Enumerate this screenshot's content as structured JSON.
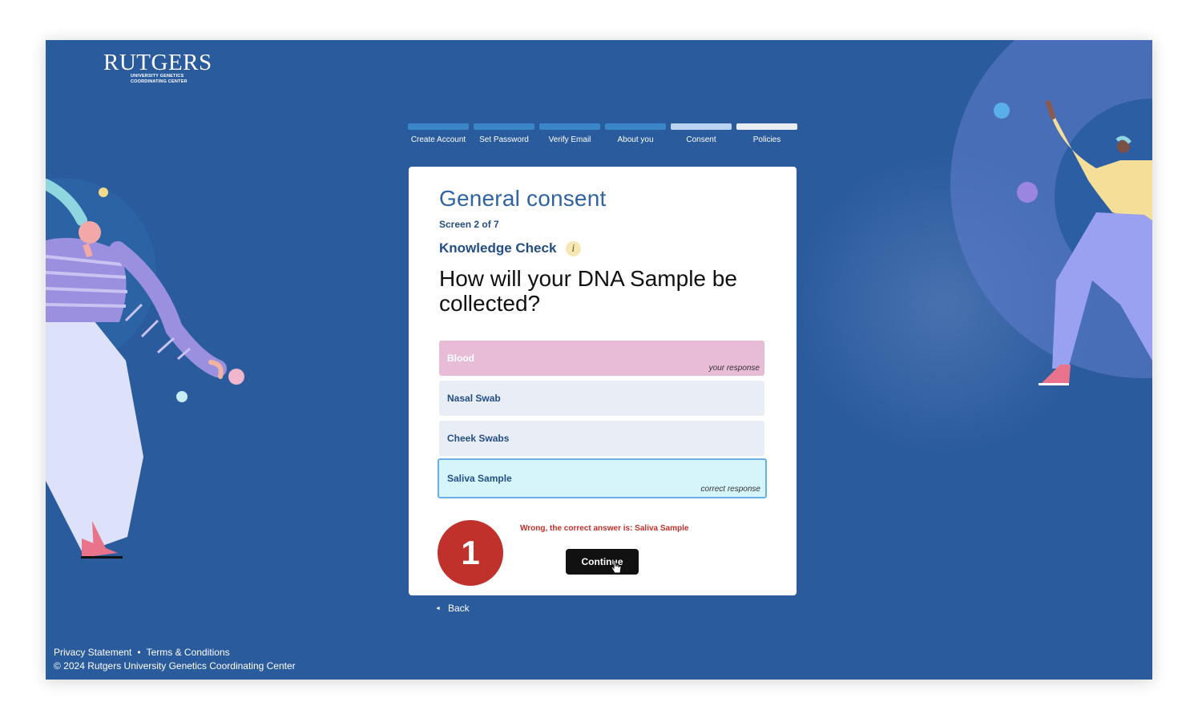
{
  "logo": {
    "word": "RUTGERS",
    "sub_line1": "UNIVERSITY GENETICS",
    "sub_line2": "COORDINATING CENTER"
  },
  "steps": [
    {
      "label": "Create Account",
      "state": "done"
    },
    {
      "label": "Set Password",
      "state": "done"
    },
    {
      "label": "Verify Email",
      "state": "done"
    },
    {
      "label": "About you",
      "state": "done"
    },
    {
      "label": "Consent",
      "state": "current"
    },
    {
      "label": "Policies",
      "state": "upcoming"
    }
  ],
  "card": {
    "title": "General consent",
    "screen_count": "Screen 2 of 7",
    "section_label": "Knowledge Check",
    "info_icon": "info-icon",
    "question": "How will your DNA Sample be collected?",
    "options": [
      {
        "label": "Blood",
        "note": "your response",
        "state": "wrong"
      },
      {
        "label": "Nasal Swab",
        "note": "",
        "state": "neutral"
      },
      {
        "label": "Cheek Swabs",
        "note": "",
        "state": "neutral"
      },
      {
        "label": "Saliva Sample",
        "note": "correct response",
        "state": "correct"
      }
    ],
    "badge_number": "1",
    "feedback": "Wrong, the correct answer is: Saliva Sample",
    "continue_label": "Continue"
  },
  "nav": {
    "back_label": "Back"
  },
  "footer": {
    "privacy": "Privacy Statement",
    "separator": "•",
    "terms": "Terms & Conditions",
    "copyright": "© 2024 Rutgers University Genetics Coordinating Center"
  },
  "colors": {
    "background": "#2a5b9c",
    "accent": "#2f63a3",
    "wrong": "#e8bcd6",
    "correct_border": "#6ab0e6",
    "error": "#c0312b"
  }
}
